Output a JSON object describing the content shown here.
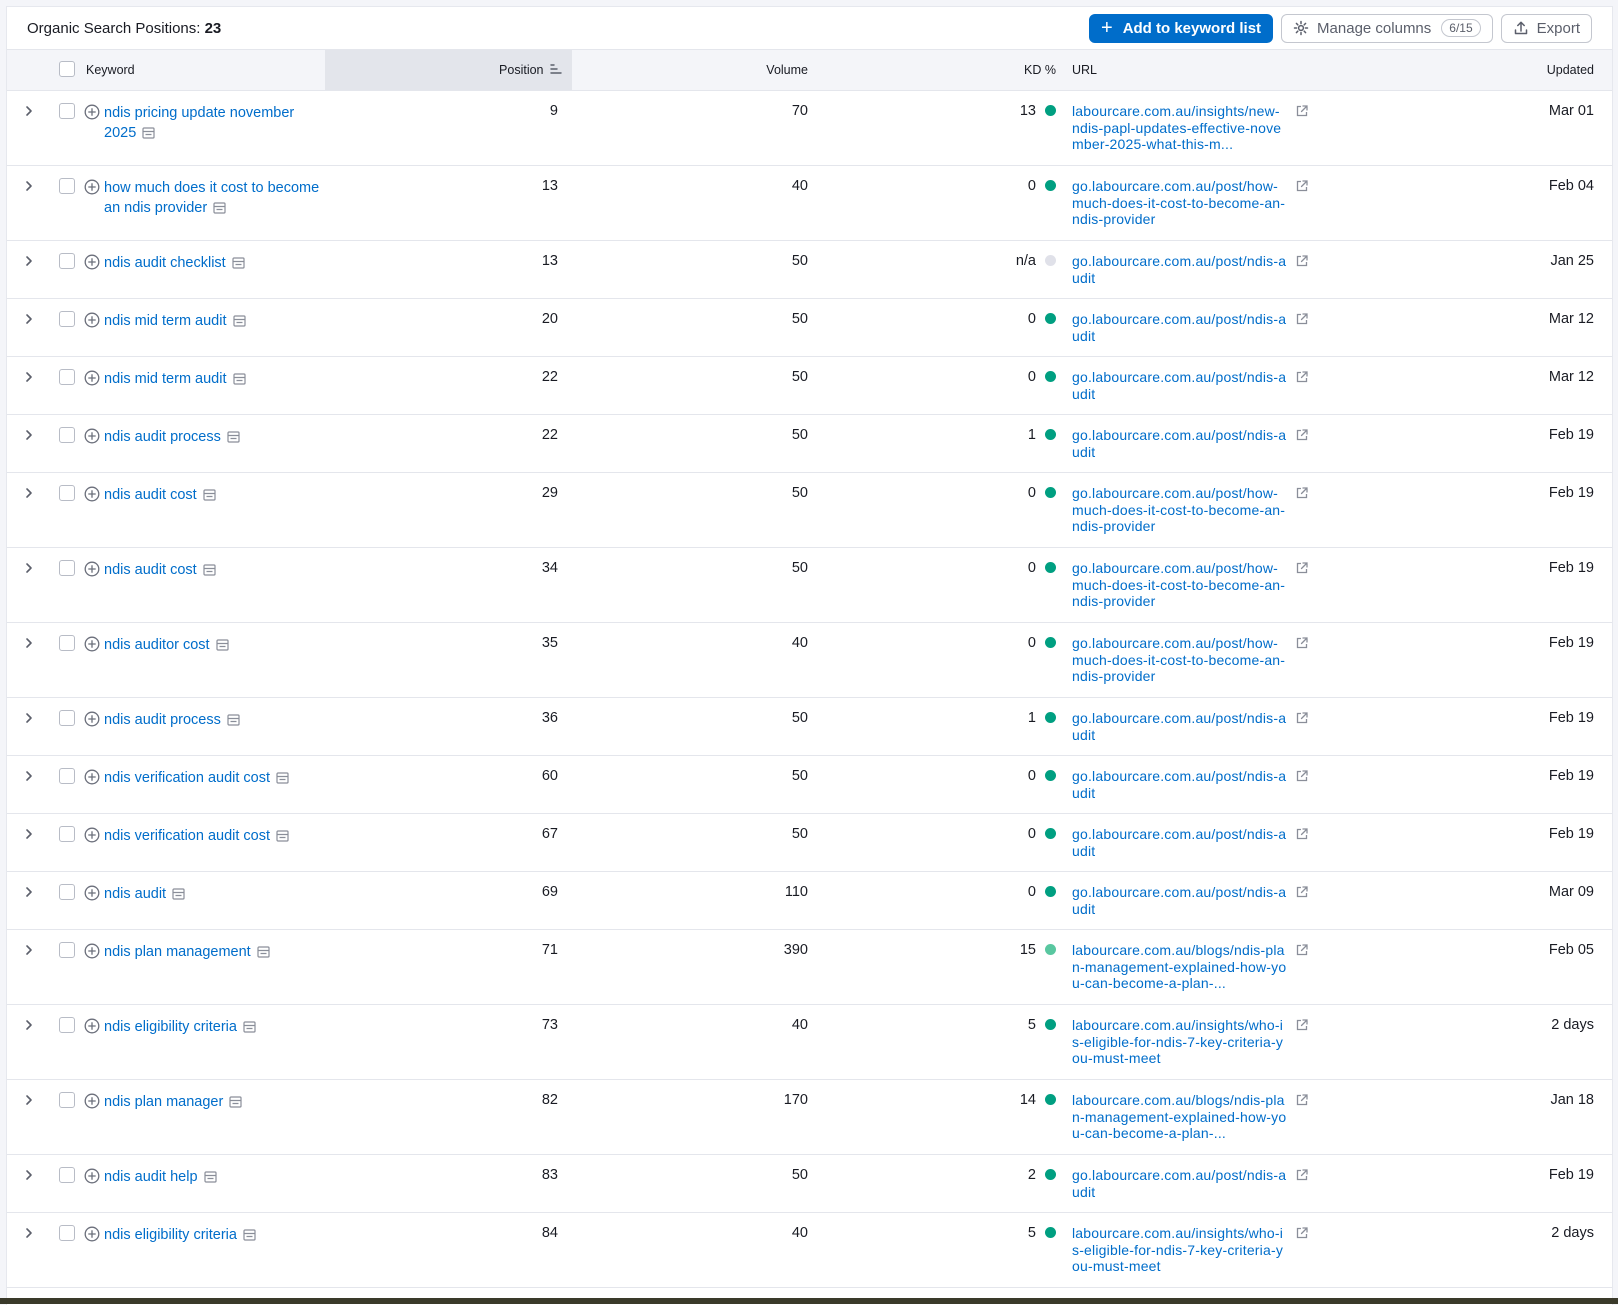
{
  "header": {
    "title_label": "Organic Search Positions:",
    "title_count": "23",
    "add_keyword_label": "Add to keyword list",
    "manage_columns_label": "Manage columns",
    "manage_columns_count": "6/15",
    "export_label": "Export"
  },
  "columns": {
    "keyword": "Keyword",
    "position": "Position",
    "volume": "Volume",
    "kd": "KD %",
    "url": "URL",
    "updated": "Updated"
  },
  "colors": {
    "accent": "#006dca",
    "kd_green": "#009f81",
    "kd_light_green": "#59c7a0",
    "kd_na": "#e0e1e9"
  },
  "rows": [
    {
      "keyword": "ndis pricing update november 2025",
      "position": "9",
      "volume": "70",
      "kd": "13",
      "kd_level": "green",
      "url": "labourcare.com.au/insights/new-ndis-papl-updates-effective-november-2025-what-this-m...",
      "updated": "Mar 01"
    },
    {
      "keyword": "how much does it cost to become an ndis provider",
      "position": "13",
      "volume": "40",
      "kd": "0",
      "kd_level": "green",
      "url": "go.labourcare.com.au/post/how-much-does-it-cost-to-become-an-ndis-provider",
      "updated": "Feb 04"
    },
    {
      "keyword": "ndis audit checklist",
      "position": "13",
      "volume": "50",
      "kd": "n/a",
      "kd_level": "na",
      "url": "go.labourcare.com.au/post/ndis-audit",
      "updated": "Jan 25"
    },
    {
      "keyword": "ndis mid term audit",
      "position": "20",
      "volume": "50",
      "kd": "0",
      "kd_level": "green",
      "url": "go.labourcare.com.au/post/ndis-audit",
      "updated": "Mar 12"
    },
    {
      "keyword": "ndis mid term audit",
      "position": "22",
      "volume": "50",
      "kd": "0",
      "kd_level": "green",
      "url": "go.labourcare.com.au/post/ndis-audit",
      "updated": "Mar 12"
    },
    {
      "keyword": "ndis audit process",
      "position": "22",
      "volume": "50",
      "kd": "1",
      "kd_level": "green",
      "url": "go.labourcare.com.au/post/ndis-audit",
      "updated": "Feb 19"
    },
    {
      "keyword": "ndis audit cost",
      "position": "29",
      "volume": "50",
      "kd": "0",
      "kd_level": "green",
      "url": "go.labourcare.com.au/post/how-much-does-it-cost-to-become-an-ndis-provider",
      "updated": "Feb 19"
    },
    {
      "keyword": "ndis audit cost",
      "position": "34",
      "volume": "50",
      "kd": "0",
      "kd_level": "green",
      "url": "go.labourcare.com.au/post/how-much-does-it-cost-to-become-an-ndis-provider",
      "updated": "Feb 19"
    },
    {
      "keyword": "ndis auditor cost",
      "position": "35",
      "volume": "40",
      "kd": "0",
      "kd_level": "green",
      "url": "go.labourcare.com.au/post/how-much-does-it-cost-to-become-an-ndis-provider",
      "updated": "Feb 19"
    },
    {
      "keyword": "ndis audit process",
      "position": "36",
      "volume": "50",
      "kd": "1",
      "kd_level": "green",
      "url": "go.labourcare.com.au/post/ndis-audit",
      "updated": "Feb 19"
    },
    {
      "keyword": "ndis verification audit cost",
      "position": "60",
      "volume": "50",
      "kd": "0",
      "kd_level": "green",
      "url": "go.labourcare.com.au/post/ndis-audit",
      "updated": "Feb 19"
    },
    {
      "keyword": "ndis verification audit cost",
      "position": "67",
      "volume": "50",
      "kd": "0",
      "kd_level": "green",
      "url": "go.labourcare.com.au/post/ndis-audit",
      "updated": "Feb 19"
    },
    {
      "keyword": "ndis audit",
      "position": "69",
      "volume": "110",
      "kd": "0",
      "kd_level": "green",
      "url": "go.labourcare.com.au/post/ndis-audit",
      "updated": "Mar 09"
    },
    {
      "keyword": "ndis plan management",
      "position": "71",
      "volume": "390",
      "kd": "15",
      "kd_level": "light",
      "url": "labourcare.com.au/blogs/ndis-plan-management-explained-how-you-can-become-a-plan-...",
      "updated": "Feb 05"
    },
    {
      "keyword": "ndis eligibility criteria",
      "position": "73",
      "volume": "40",
      "kd": "5",
      "kd_level": "green",
      "url": "labourcare.com.au/insights/who-is-eligible-for-ndis-7-key-criteria-you-must-meet",
      "updated": "2 days"
    },
    {
      "keyword": "ndis plan manager",
      "position": "82",
      "volume": "170",
      "kd": "14",
      "kd_level": "green",
      "url": "labourcare.com.au/blogs/ndis-plan-management-explained-how-you-can-become-a-plan-...",
      "updated": "Jan 18"
    },
    {
      "keyword": "ndis audit help",
      "position": "83",
      "volume": "50",
      "kd": "2",
      "kd_level": "green",
      "url": "go.labourcare.com.au/post/ndis-audit",
      "updated": "Feb 19"
    },
    {
      "keyword": "ndis eligibility criteria",
      "position": "84",
      "volume": "40",
      "kd": "5",
      "kd_level": "green",
      "url": "labourcare.com.au/insights/who-is-eligible-for-ndis-7-key-criteria-you-must-meet",
      "updated": "2 days"
    }
  ]
}
